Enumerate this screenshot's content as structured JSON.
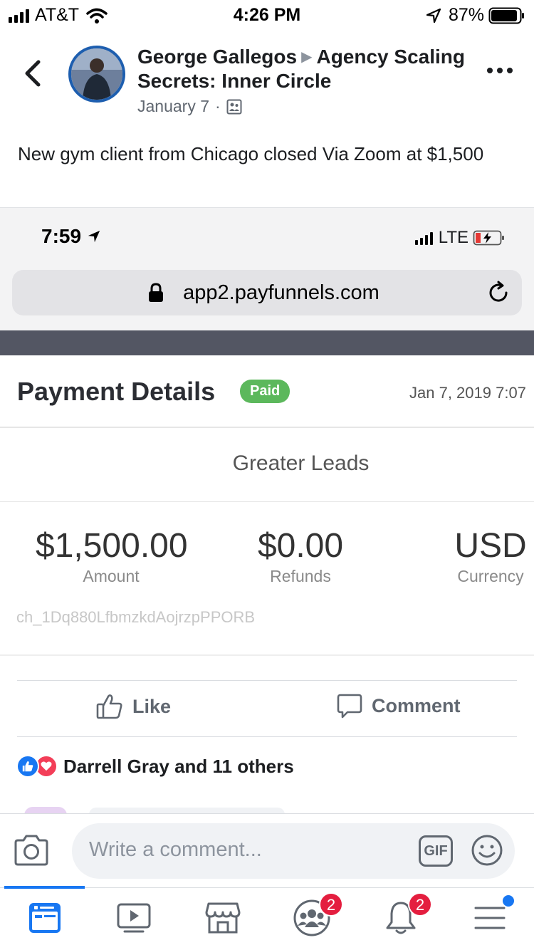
{
  "status_bar": {
    "carrier": "AT&T",
    "time": "4:26 PM",
    "battery": "87%"
  },
  "post": {
    "author": "George Gallegos",
    "group": "Agency Scaling Secrets: Inner Circle",
    "date": "January 7",
    "meta_separator": "·",
    "text": "New gym client from Chicago closed Via Zoom at $1,500"
  },
  "screenshot": {
    "time": "7:59",
    "network": "LTE",
    "url": "app2.payfunnels.com",
    "payment": {
      "title": "Payment Details",
      "status": "Paid",
      "date": "Jan 7, 2019 7:07",
      "merchant": "Greater Leads",
      "amount_value": "$1,500.00",
      "amount_label": "Amount",
      "refunds_value": "$0.00",
      "refunds_label": "Refunds",
      "currency_value": "USD",
      "currency_label": "Currency",
      "charge_id": "ch_1Dq880LfbmzkdAojrzpPPORB"
    }
  },
  "actions": {
    "like": "Like",
    "comment": "Comment"
  },
  "reactions": {
    "summary": "Darrell Gray and 11 others"
  },
  "composer": {
    "placeholder": "Write a comment...",
    "gif": "GIF"
  },
  "nav": {
    "groups_badge": "2",
    "notifications_badge": "2"
  },
  "colors": {
    "accent": "#1877f2",
    "paid_badge": "#5cb85c",
    "notification_badge": "#e41e3f"
  }
}
